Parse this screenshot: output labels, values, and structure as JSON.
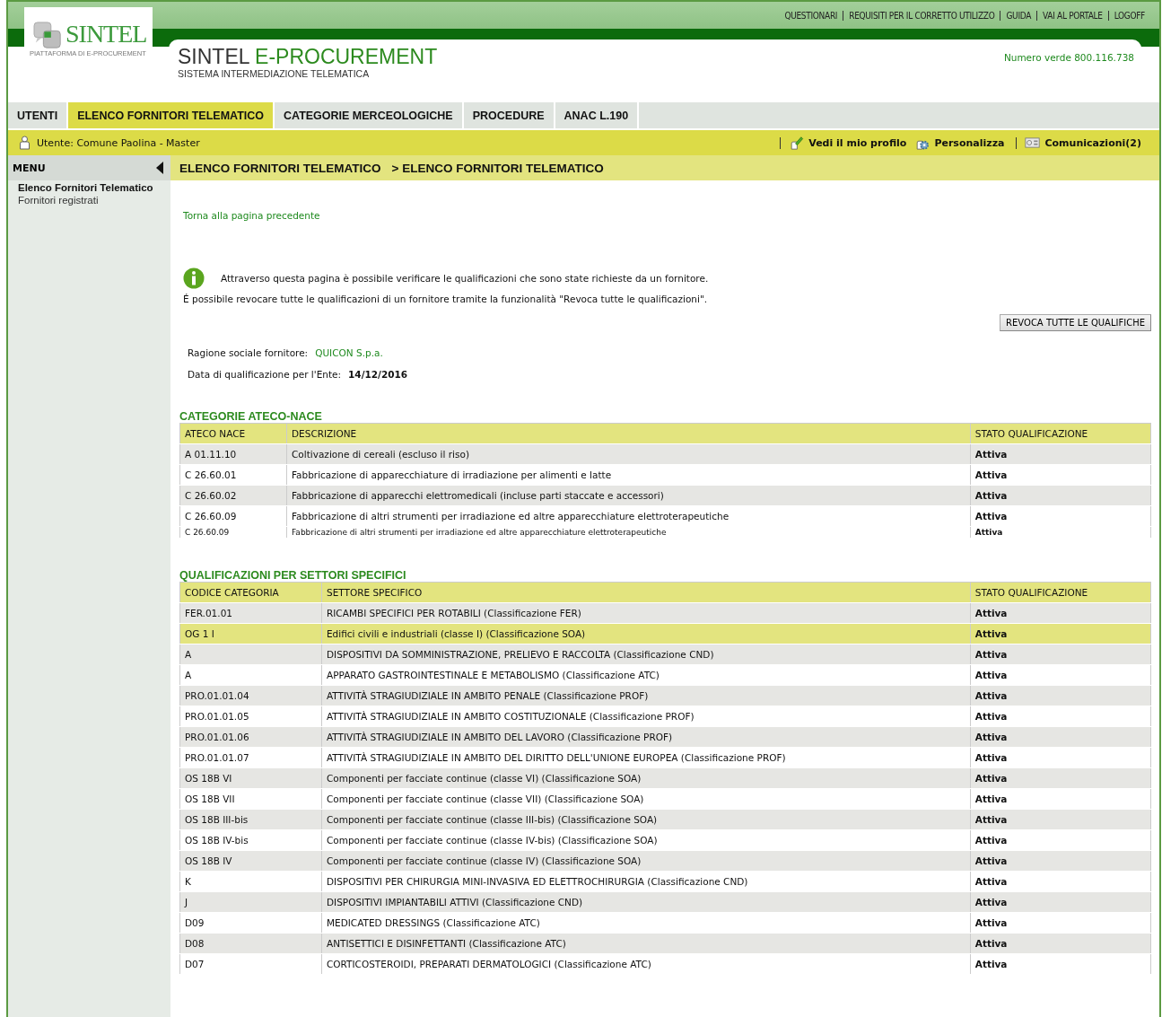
{
  "top_links": [
    "QUESTIONARI",
    "REQUISITI PER IL CORRETTO UTILIZZO",
    "GUIDA",
    "VAI AL PORTALE",
    "LOGOFF"
  ],
  "logo": {
    "name": "SINTEL",
    "tagline": "PIATTAFORMA DI E-PROCUREMENT"
  },
  "title": {
    "part1": "SINTEL",
    "part2": "E-PROCUREMENT",
    "subtitle": "SISTEMA INTERMEDIAZIONE TELEMATICA"
  },
  "hotline": "Numero verde 800.116.738",
  "tabs": [
    {
      "label": "UTENTI",
      "selected": false
    },
    {
      "label": "ELENCO FORNITORI TELEMATICO",
      "selected": true
    },
    {
      "label": "CATEGORIE MERCEOLOGICHE",
      "selected": false
    },
    {
      "label": "PROCEDURE",
      "selected": false
    },
    {
      "label": "ANAC L.190",
      "selected": false
    }
  ],
  "user_bar": {
    "user": "Utente: Comune Paolina - Master",
    "profile": "Vedi il mio profilo",
    "customize": "Personalizza",
    "messages": "Comunicazioni(2)"
  },
  "sidebar": {
    "title": "MENU",
    "items": [
      {
        "label": "Elenco Fornitori Telematico",
        "selected": true
      },
      {
        "label": "Fornitori registrati",
        "selected": false
      }
    ]
  },
  "breadcrumb": [
    "ELENCO FORNITORI TELEMATICO",
    "> ELENCO FORNITORI TELEMATICO"
  ],
  "back_link": "Torna alla pagina precedente",
  "info": [
    "Attraverso questa pagina è possibile verificare le qualificazioni che sono state richieste da un fornitore.",
    "É possibile revocare tutte le qualificazioni di un fornitore tramite la funzionalità \"Revoca tutte le qualificazioni\"."
  ],
  "revoke_button": "REVOCA TUTTE LE QUALIFICHE",
  "supplier": {
    "name_label": "Ragione sociale fornitore:",
    "name": "QUICON S.p.a.",
    "date_label": "Data di qualificazione per l'Ente:",
    "date": "14/12/2016"
  },
  "ateco_table": {
    "title": "CATEGORIE ATECO-NACE",
    "columns": [
      "ATECO NACE",
      "DESCRIZIONE",
      "STATO QUALIFICAZIONE"
    ],
    "rows": [
      {
        "kind": "full",
        "cells": [
          "A 01.11.10",
          "Coltivazione di cereali (escluso il riso)",
          "Attiva"
        ]
      },
      {
        "kind": "full",
        "cells": [
          "C 26.60.01",
          "Fabbricazione di apparecchiature di irradiazione per alimenti e latte",
          "Attiva"
        ]
      },
      {
        "kind": "full",
        "cells": [
          "C 26.60.02",
          "Fabbricazione di apparecchi elettromedicali (incluse parti staccate e accessori)",
          "Attiva"
        ]
      },
      {
        "kind": "full",
        "cells": [
          "C 26.60.09",
          "Fabbricazione di altri strumenti per irradiazione ed altre apparecchiature elettroterapeutiche",
          "Attiva"
        ]
      },
      {
        "kind": "clipped",
        "cells": [
          "C 26.60.09",
          "Fabbricazione di altri strumenti per irradiazione ed altre apparecchiature elettroterapeutiche",
          "Attiva"
        ]
      }
    ]
  },
  "sector_table": {
    "title": "QUALIFICAZIONI PER SETTORI SPECIFICI",
    "columns": [
      "CODICE CATEGORIA",
      "SETTORE SPECIFICO",
      "STATO QUALIFICAZIONE"
    ],
    "rows": [
      {
        "selected": false,
        "cells": [
          "FER.01.01",
          "RICAMBI SPECIFICI PER ROTABILI  (Classificazione FER)",
          "Attiva"
        ]
      },
      {
        "selected": true,
        "cells": [
          "OG 1 I",
          "Edifici civili e industriali (classe I)  (Classificazione SOA)",
          "Attiva"
        ]
      },
      {
        "selected": false,
        "cells": [
          "A",
          "DISPOSITIVI DA SOMMINISTRAZIONE, PRELIEVO E RACCOLTA  (Classificazione CND)",
          "Attiva"
        ]
      },
      {
        "selected": false,
        "cells": [
          "A",
          "APPARATO GASTROINTESTINALE E METABOLISMO  (Classificazione ATC)",
          "Attiva"
        ]
      },
      {
        "selected": false,
        "cells": [
          "PRO.01.01.04",
          "ATTIVITÀ STRAGIUDIZIALE IN AMBITO PENALE  (Classificazione PROF)",
          "Attiva"
        ]
      },
      {
        "selected": false,
        "cells": [
          "PRO.01.01.05",
          "ATTIVITÀ STRAGIUDIZIALE IN AMBITO COSTITUZIONALE  (Classificazione PROF)",
          "Attiva"
        ]
      },
      {
        "selected": false,
        "cells": [
          "PRO.01.01.06",
          "ATTIVITÀ STRAGIUDIZIALE IN AMBITO DEL LAVORO  (Classificazione PROF)",
          "Attiva"
        ]
      },
      {
        "selected": false,
        "cells": [
          "PRO.01.01.07",
          "ATTIVITÀ STRAGIUDIZIALE IN AMBITO DEL DIRITTO DELL'UNIONE EUROPEA  (Classificazione PROF)",
          "Attiva"
        ]
      },
      {
        "selected": false,
        "cells": [
          "OS 18B VI",
          "Componenti per facciate continue (classe VI)  (Classificazione SOA)",
          "Attiva"
        ]
      },
      {
        "selected": false,
        "cells": [
          "OS 18B VII",
          "Componenti per facciate continue (classe VII)  (Classificazione SOA)",
          "Attiva"
        ]
      },
      {
        "selected": false,
        "cells": [
          "OS 18B III-bis",
          "Componenti per facciate continue (classe III-bis)  (Classificazione SOA)",
          "Attiva"
        ]
      },
      {
        "selected": false,
        "cells": [
          "OS 18B IV-bis",
          "Componenti per facciate continue (classe IV-bis)  (Classificazione SOA)",
          "Attiva"
        ]
      },
      {
        "selected": false,
        "cells": [
          "OS 18B IV",
          "Componenti per facciate continue (classe IV)  (Classificazione SOA)",
          "Attiva"
        ]
      },
      {
        "selected": false,
        "cells": [
          "K",
          "DISPOSITIVI PER CHIRURGIA MINI-INVASIVA ED ELETTROCHIRURGIA  (Classificazione CND)",
          "Attiva"
        ]
      },
      {
        "selected": false,
        "cells": [
          "J",
          "DISPOSITIVI IMPIANTABILI ATTIVI  (Classificazione CND)",
          "Attiva"
        ]
      },
      {
        "selected": false,
        "cells": [
          "D09",
          "MEDICATED DRESSINGS  (Classificazione ATC)",
          "Attiva"
        ]
      },
      {
        "selected": false,
        "cells": [
          "D08",
          "ANTISETTICI E DISINFETTANTI  (Classificazione ATC)",
          "Attiva"
        ]
      },
      {
        "selected": false,
        "cells": [
          "D07",
          "CORTICOSTEROIDI, PREPARATI DERMATOLOGICI  (Classificazione ATC)",
          "Attiva"
        ]
      }
    ]
  }
}
